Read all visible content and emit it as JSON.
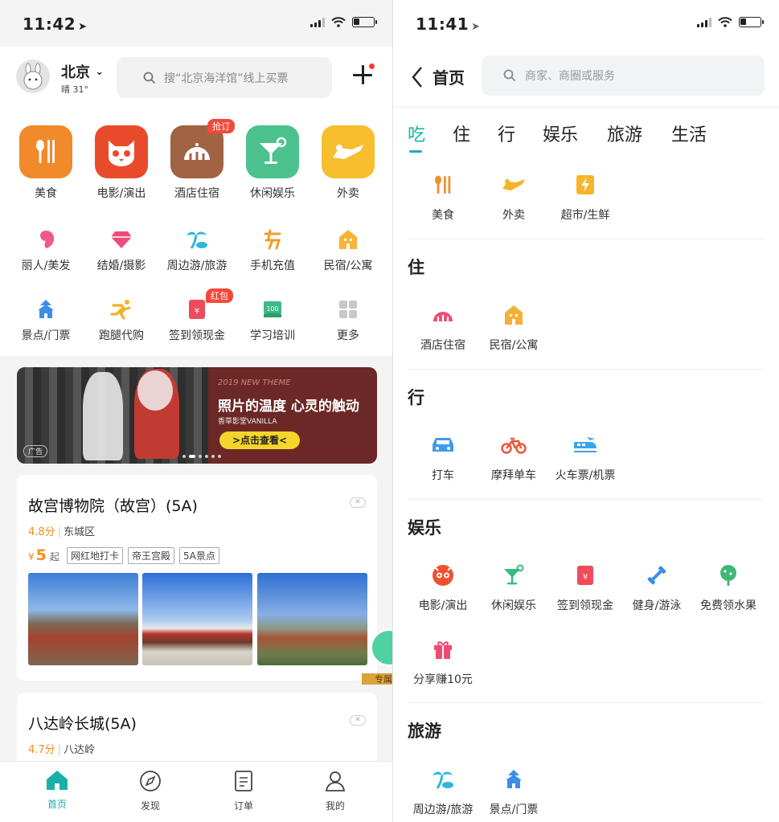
{
  "left": {
    "status": {
      "time": "11:42",
      "arrow": "➤"
    },
    "header": {
      "city": "北京",
      "weather": "晴 31°",
      "search_placeholder": "搜“北京海洋馆”线上买票"
    },
    "big_icons": [
      {
        "label": "美食",
        "color": "#f08a2a",
        "icon": "fork-knife-icon"
      },
      {
        "label": "电影/演出",
        "color": "#ea4a2c",
        "icon": "cat-icon"
      },
      {
        "label": "酒店住宿",
        "color": "#a06343",
        "icon": "hotel-icon",
        "tag": "抢订"
      },
      {
        "label": "休闲娱乐",
        "color": "#4bc28e",
        "icon": "cocktail-icon"
      },
      {
        "label": "外卖",
        "color": "#f7be2d",
        "icon": "delivery-icon"
      }
    ],
    "small_icons_row1": [
      {
        "label": "丽人/美发",
        "color": "#ee5a8a",
        "icon": "woman-icon"
      },
      {
        "label": "结婚/摄影",
        "color": "#ee4c7b",
        "icon": "diamond-icon"
      },
      {
        "label": "周边游/旅游",
        "color": "#2fb7d8",
        "icon": "palm-icon"
      },
      {
        "label": "手机充值",
        "color": "#f39c2a",
        "icon": "recharge-icon"
      },
      {
        "label": "民宿/公寓",
        "color": "#f6b334",
        "icon": "house-icon"
      }
    ],
    "small_icons_row2": [
      {
        "label": "景点/门票",
        "color": "#3d8ee8",
        "icon": "temple-icon"
      },
      {
        "label": "跑腿代购",
        "color": "#f5b021",
        "icon": "runner-icon"
      },
      {
        "label": "签到领现金",
        "color": "#f04b5a",
        "icon": "redpacket-icon",
        "tag": "红包"
      },
      {
        "label": "学习培训",
        "color": "#40b888",
        "icon": "book-icon"
      },
      {
        "label": "更多",
        "color": "#c8c8c8",
        "icon": "grid-icon"
      }
    ],
    "banner": {
      "theme": "2019 NEW THEME",
      "headline": "照片的温度 心灵的触动",
      "sub": "香草影堂VANILLA",
      "button": ">点击查看<",
      "ad": "广告"
    },
    "cards": [
      {
        "title": "故宫博物院（故宫）(5A)",
        "score": "4.8分",
        "area": "东城区",
        "currency": "¥",
        "price": "5",
        "price_suffix": "起",
        "tags": [
          "网红地打卡",
          "帝王宫殿",
          "5A景点"
        ]
      },
      {
        "title": "八达岭长城(5A)",
        "score": "4.7分",
        "area": "八达岭"
      }
    ],
    "badge": {
      "text": "专属"
    },
    "tabs": [
      {
        "label": "首页",
        "icon": "home-icon"
      },
      {
        "label": "发现",
        "icon": "compass-icon"
      },
      {
        "label": "订单",
        "icon": "order-icon"
      },
      {
        "label": "我的",
        "icon": "user-icon"
      }
    ]
  },
  "right": {
    "status": {
      "time": "11:41",
      "arrow": "➤"
    },
    "header": {
      "back_title": "首页",
      "search_placeholder": "商家、商圈或服务"
    },
    "categories": [
      "吃",
      "住",
      "行",
      "娱乐",
      "旅游",
      "生活"
    ],
    "sections": [
      {
        "items": [
          {
            "label": "美食",
            "color": "#f0912e",
            "icon": "fork-knife-icon"
          },
          {
            "label": "外卖",
            "color": "#f5b52a",
            "icon": "delivery-icon"
          },
          {
            "label": "超市/生鲜",
            "color": "#f7b52e",
            "icon": "lightning-icon"
          }
        ]
      },
      {
        "title": "住",
        "items": [
          {
            "label": "酒店住宿",
            "color": "#ee4c73",
            "icon": "hotel-icon"
          },
          {
            "label": "民宿/公寓",
            "color": "#f5b136",
            "icon": "house-icon"
          }
        ]
      },
      {
        "title": "行",
        "items": [
          {
            "label": "打车",
            "color": "#3d9be8",
            "icon": "car-icon"
          },
          {
            "label": "摩拜单车",
            "color": "#f0543a",
            "icon": "bike-icon"
          },
          {
            "label": "火车票/机票",
            "color": "#3da3e8",
            "icon": "train-icon"
          }
        ]
      },
      {
        "title": "娱乐",
        "items": [
          {
            "label": "电影/演出",
            "color": "#f0502e",
            "icon": "cat-icon"
          },
          {
            "label": "休闲娱乐",
            "color": "#36bd7e",
            "icon": "cocktail-icon"
          },
          {
            "label": "签到领现金",
            "color": "#f04b5a",
            "icon": "redpacket-icon"
          },
          {
            "label": "健身/游泳",
            "color": "#3d8ee8",
            "icon": "dumbbell-icon"
          },
          {
            "label": "免费领水果",
            "color": "#3fb877",
            "icon": "tree-icon"
          },
          {
            "label": "分享赚10元",
            "color": "#ee4c73",
            "icon": "gift-icon"
          }
        ]
      },
      {
        "title": "旅游",
        "items": [
          {
            "label": "周边游/旅游",
            "color": "#2fb7d8",
            "icon": "palm-icon"
          },
          {
            "label": "景点/门票",
            "color": "#3d8ee8",
            "icon": "temple-icon"
          }
        ]
      }
    ]
  }
}
